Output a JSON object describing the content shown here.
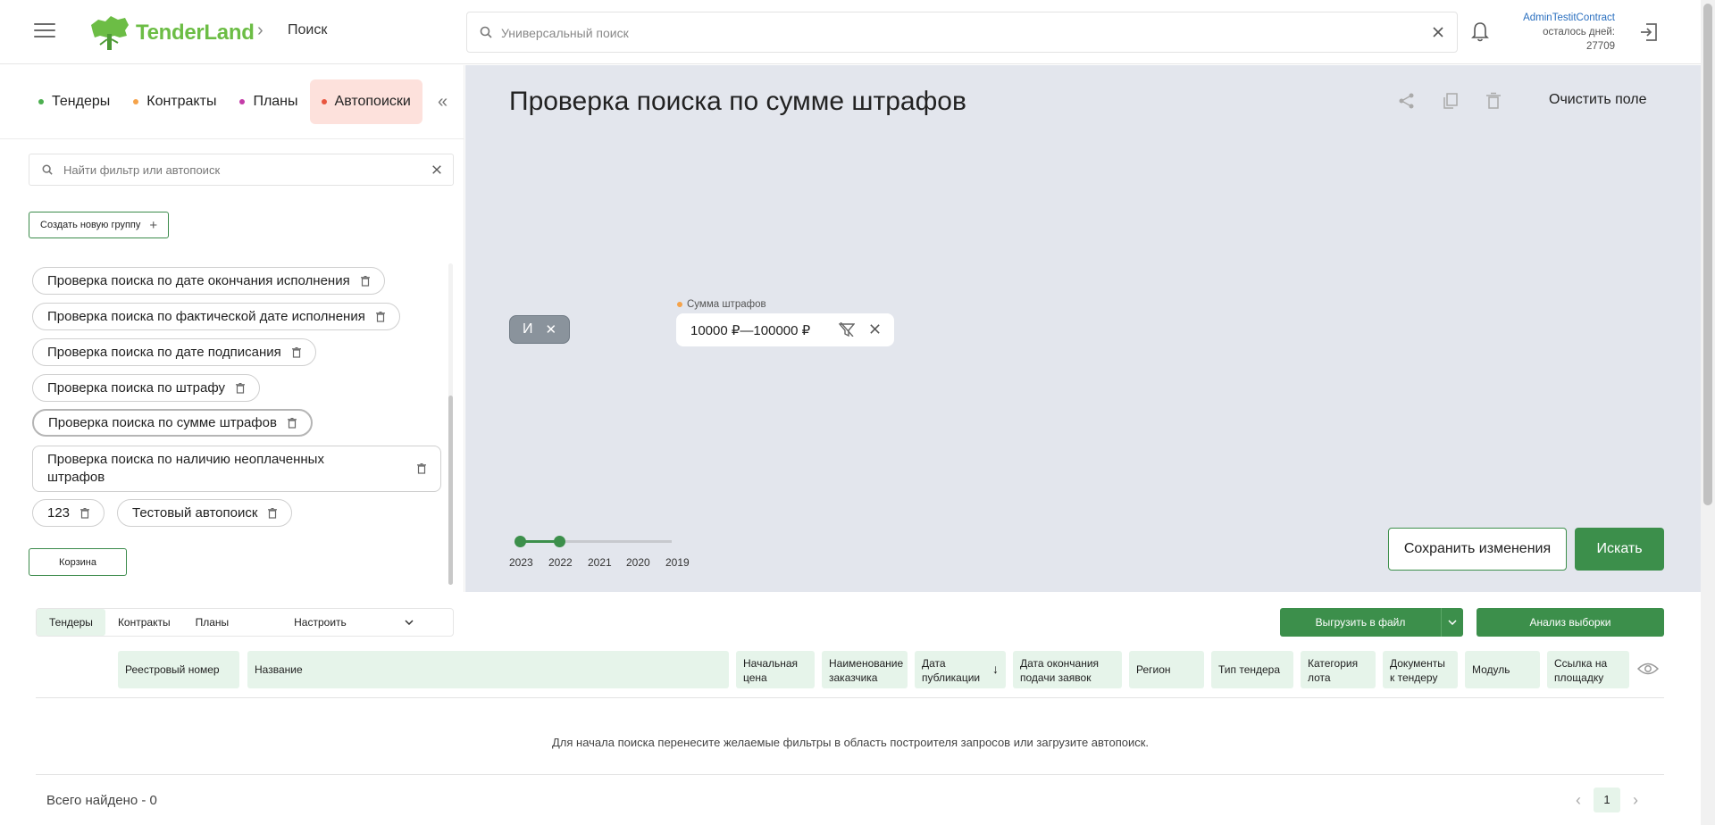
{
  "header": {
    "logo_text": "TenderLand",
    "breadcrumb": "Поиск",
    "search_placeholder": "Универсальный поиск",
    "user_name": "AdminTestitContract",
    "days_label": "осталось дней:",
    "days_value": "27709"
  },
  "left_panel": {
    "tabs": [
      {
        "label": "Тендеры",
        "color": "#4caf50"
      },
      {
        "label": "Контракты",
        "color": "#f5a34a"
      },
      {
        "label": "Планы",
        "color": "#c43ca8"
      },
      {
        "label": "Автопоиски",
        "color": "#e8563f"
      }
    ],
    "filter_placeholder": "Найти фильтр или автопоиск",
    "create_group_label": "Создать новую группу",
    "saved_searches": [
      "Проверка поиска по дате окончания исполнения",
      "Проверка поиска по фактической дате исполнения",
      "Проверка поиска по дате подписания",
      "Проверка поиска по штрафу",
      "Проверка поиска по сумме штрафов",
      "Проверка поиска по наличию неоплаченных штрафов",
      "123",
      "Тестовый автопоиск"
    ],
    "basket_label": "Корзина"
  },
  "builder": {
    "title": "Проверка поиска по сумме штрафов",
    "clear_label": "Очистить поле",
    "and_label": "И",
    "filter_name": "Сумма штрафов",
    "filter_value": "10000 ₽—100000 ₽",
    "years": [
      "2023",
      "2022",
      "2021",
      "2020",
      "2019"
    ],
    "save_label": "Сохранить изменения",
    "search_label": "Искать"
  },
  "results": {
    "tabs": [
      "Тендеры",
      "Контракты",
      "Планы"
    ],
    "configure_label": "Настроить",
    "export_label": "Выгрузить в файл",
    "analysis_label": "Анализ выборки",
    "columns": [
      "Реестровый номер",
      "Название",
      "Начальная цена",
      "Наименование заказчика",
      "Дата публикации",
      "Дата окончания подачи заявок",
      "Регион",
      "Тип тендера",
      "Категория лота",
      "Документы к тендеру",
      "Модуль",
      "Ссылка на площадку"
    ],
    "empty_message": "Для начала поиска перенесите желаемые фильтры в область построителя запросов или загрузите автопоиск.",
    "total_label": "Всего найдено - 0",
    "current_page": "1"
  }
}
